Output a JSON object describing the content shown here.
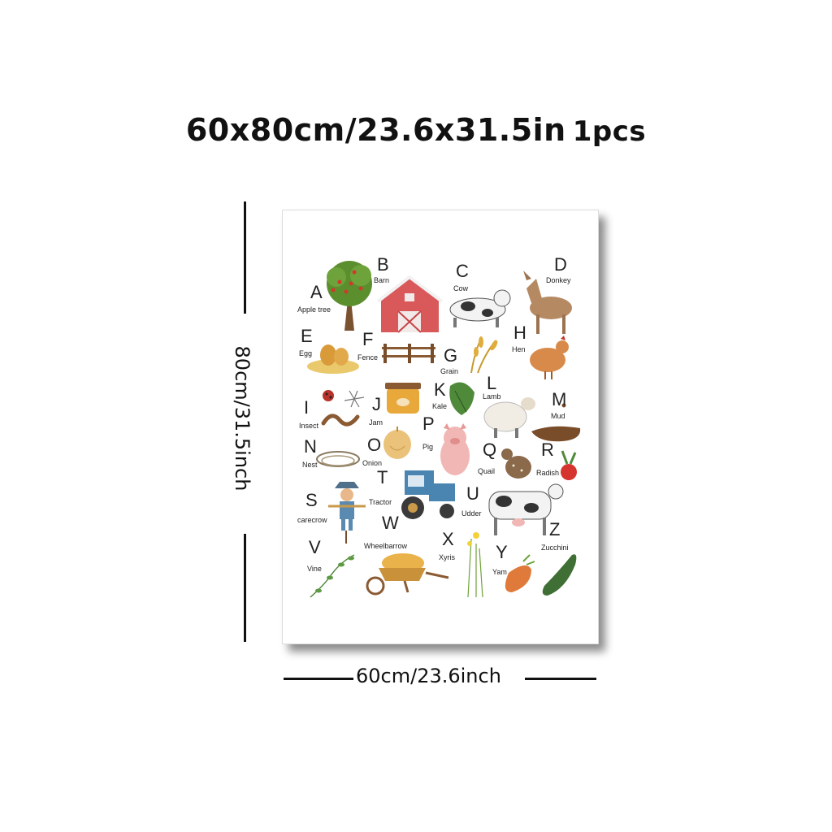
{
  "header": {
    "size_text": "60x80cm/23.6x31.5in",
    "quantity_text": "1pcs"
  },
  "dimensions": {
    "height_label": "80cm/31.5inch",
    "width_label": "60cm/23.6inch"
  },
  "poster": {
    "entries": [
      {
        "letter": "A",
        "word": "Apple tree",
        "icon": "apple-tree-icon"
      },
      {
        "letter": "B",
        "word": "Barn",
        "icon": "barn-icon"
      },
      {
        "letter": "C",
        "word": "Cow",
        "icon": "cow-icon"
      },
      {
        "letter": "D",
        "word": "Donkey",
        "icon": "donkey-icon"
      },
      {
        "letter": "E",
        "word": "Egg",
        "icon": "egg-icon"
      },
      {
        "letter": "F",
        "word": "Fence",
        "icon": "fence-icon"
      },
      {
        "letter": "G",
        "word": "Grain",
        "icon": "grain-icon"
      },
      {
        "letter": "H",
        "word": "Hen",
        "icon": "hen-icon"
      },
      {
        "letter": "I",
        "word": "Insect",
        "icon": "insect-icon"
      },
      {
        "letter": "J",
        "word": "Jam",
        "icon": "jam-icon"
      },
      {
        "letter": "K",
        "word": "Kale",
        "icon": "kale-icon"
      },
      {
        "letter": "L",
        "word": "Lamb",
        "icon": "lamb-icon"
      },
      {
        "letter": "M",
        "word": "Mud",
        "icon": "mud-icon"
      },
      {
        "letter": "N",
        "word": "Nest",
        "icon": "nest-icon"
      },
      {
        "letter": "O",
        "word": "Onion",
        "icon": "onion-icon"
      },
      {
        "letter": "P",
        "word": "Pig",
        "icon": "pig-icon"
      },
      {
        "letter": "Q",
        "word": "Quail",
        "icon": "quail-icon"
      },
      {
        "letter": "R",
        "word": "Radish",
        "icon": "radish-icon"
      },
      {
        "letter": "S",
        "word": "carecrow",
        "icon": "scarecrow-icon"
      },
      {
        "letter": "T",
        "word": "Tractor",
        "icon": "tractor-icon"
      },
      {
        "letter": "U",
        "word": "Udder",
        "icon": "udder-icon"
      },
      {
        "letter": "V",
        "word": "Vine",
        "icon": "vine-icon"
      },
      {
        "letter": "W",
        "word": "Wheelbarrow",
        "icon": "wheelbarrow-icon"
      },
      {
        "letter": "X",
        "word": "Xyris",
        "icon": "xyris-icon"
      },
      {
        "letter": "Y",
        "word": "Yam",
        "icon": "yam-icon"
      },
      {
        "letter": "Z",
        "word": "Zucchini",
        "icon": "zucchini-icon"
      }
    ]
  }
}
